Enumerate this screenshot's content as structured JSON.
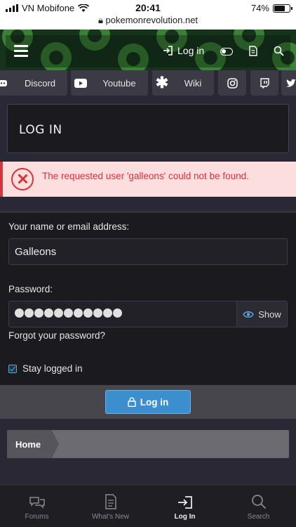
{
  "status_bar": {
    "carrier": "VN Mobifone",
    "time": "20:41",
    "url": "pokemonrevolution.net",
    "battery": "74%",
    "battery_level": 0.74
  },
  "nav": {
    "login_label": "Log in"
  },
  "links": [
    {
      "label": "Discord",
      "icon": "discord-icon"
    },
    {
      "label": "Youtube",
      "icon": "youtube-icon"
    },
    {
      "label": "Wiki",
      "icon": "asterisk-icon"
    },
    {
      "label": "",
      "icon": "instagram-icon"
    },
    {
      "label": "",
      "icon": "twitch-icon"
    },
    {
      "label": "",
      "icon": "twitter-icon"
    }
  ],
  "page": {
    "title": "LOG IN"
  },
  "error": {
    "message": "The requested user 'galleons' could not be found."
  },
  "form": {
    "name_label": "Your name or email address:",
    "name_value": "Galleons",
    "password_label": "Password:",
    "password_dots": 11,
    "show_label": "Show",
    "forgot_label": "Forgot your password?",
    "stay_label": "Stay logged in",
    "stay_checked": true,
    "submit_label": "Log in"
  },
  "breadcrumb": {
    "home": "Home"
  },
  "bottom_nav": [
    {
      "label": "Forums",
      "icon": "forums-icon",
      "active": false
    },
    {
      "label": "What's New",
      "icon": "document-icon",
      "active": false
    },
    {
      "label": "Log In",
      "icon": "login-icon",
      "active": true
    },
    {
      "label": "Search",
      "icon": "search-icon",
      "active": false
    }
  ],
  "colors": {
    "accent": "#3b8fcf",
    "error": "#d8343c",
    "background": "#2a2834"
  }
}
